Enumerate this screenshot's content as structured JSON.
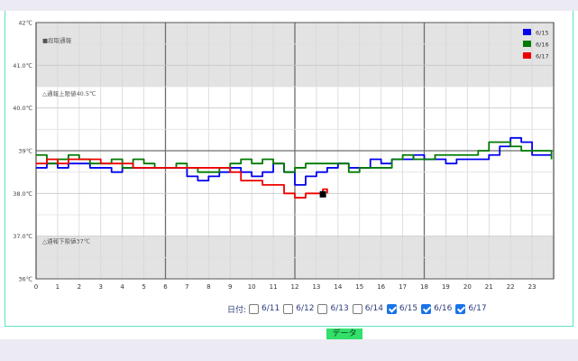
{
  "chart_data": {
    "type": "line",
    "x_range": [
      0,
      24
    ],
    "y_range": [
      36,
      42
    ],
    "x_ticks": [
      "0",
      "1",
      "2",
      "3",
      "4",
      "5",
      "6",
      "7",
      "8",
      "9",
      "10",
      "11",
      "12",
      "13",
      "14",
      "15",
      "16",
      "17",
      "18",
      "19",
      "20",
      "21",
      "22",
      "23"
    ],
    "y_ticks": [
      {
        "v": 36,
        "label": "36℃"
      },
      {
        "v": 37,
        "label": "37.0℃"
      },
      {
        "v": 38,
        "label": "38.0℃"
      },
      {
        "v": 39,
        "label": "39℃"
      },
      {
        "v": 40,
        "label": "40.0℃"
      },
      {
        "v": 41,
        "label": "41.0℃"
      },
      {
        "v": 42,
        "label": "42℃"
      }
    ],
    "bands": [
      {
        "from": 40.5,
        "to": 42,
        "label": "■段取通報",
        "label_y": 41.6,
        "color": "#e3e3e3"
      },
      {
        "from": 40.5,
        "to": 40.5,
        "label": "△通報上限値40.5℃",
        "label_y": 40.35,
        "color": ""
      },
      {
        "from": 36,
        "to": 37,
        "label": "△通報下限値37℃",
        "label_y": 36.9,
        "color": "#e3e3e3"
      }
    ],
    "series": [
      {
        "name": "6/15",
        "color": "#0000ee",
        "points": [
          [
            0,
            38.6
          ],
          [
            0.5,
            38.7
          ],
          [
            1,
            38.6
          ],
          [
            1.5,
            38.7
          ],
          [
            2,
            38.7
          ],
          [
            2.5,
            38.6
          ],
          [
            3,
            38.6
          ],
          [
            3.5,
            38.5
          ],
          [
            4,
            38.6
          ],
          [
            4.5,
            38.6
          ],
          [
            5,
            38.6
          ],
          [
            5.5,
            38.6
          ],
          [
            6,
            38.6
          ],
          [
            6.5,
            38.6
          ],
          [
            7,
            38.4
          ],
          [
            7.5,
            38.3
          ],
          [
            8,
            38.4
          ],
          [
            8.5,
            38.5
          ],
          [
            9,
            38.6
          ],
          [
            9.5,
            38.5
          ],
          [
            10,
            38.4
          ],
          [
            10.5,
            38.5
          ],
          [
            11,
            38.7
          ],
          [
            11.5,
            38.5
          ],
          [
            12,
            38.2
          ],
          [
            12.5,
            38.4
          ],
          [
            13,
            38.5
          ],
          [
            13.5,
            38.6
          ],
          [
            14,
            38.7
          ],
          [
            14.5,
            38.6
          ],
          [
            15,
            38.6
          ],
          [
            15.5,
            38.8
          ],
          [
            16,
            38.7
          ],
          [
            16.5,
            38.8
          ],
          [
            17,
            38.8
          ],
          [
            17.5,
            38.9
          ],
          [
            18,
            38.8
          ],
          [
            18.5,
            38.8
          ],
          [
            19,
            38.7
          ],
          [
            19.5,
            38.8
          ],
          [
            20,
            38.8
          ],
          [
            20.5,
            38.8
          ],
          [
            21,
            38.9
          ],
          [
            21.5,
            39.1
          ],
          [
            22,
            39.3
          ],
          [
            22.5,
            39.2
          ],
          [
            23,
            38.9
          ],
          [
            23.5,
            38.9
          ],
          [
            23.9,
            38.9
          ]
        ]
      },
      {
        "name": "6/16",
        "color": "#007a00",
        "points": [
          [
            0,
            38.9
          ],
          [
            0.5,
            38.7
          ],
          [
            1,
            38.8
          ],
          [
            1.5,
            38.9
          ],
          [
            2,
            38.8
          ],
          [
            2.5,
            38.7
          ],
          [
            3,
            38.7
          ],
          [
            3.5,
            38.8
          ],
          [
            4,
            38.6
          ],
          [
            4.5,
            38.8
          ],
          [
            5,
            38.7
          ],
          [
            5.5,
            38.6
          ],
          [
            6,
            38.6
          ],
          [
            6.5,
            38.7
          ],
          [
            7,
            38.6
          ],
          [
            7.5,
            38.5
          ],
          [
            8,
            38.5
          ],
          [
            8.5,
            38.6
          ],
          [
            9,
            38.7
          ],
          [
            9.5,
            38.8
          ],
          [
            10,
            38.7
          ],
          [
            10.5,
            38.8
          ],
          [
            11,
            38.7
          ],
          [
            11.5,
            38.5
          ],
          [
            12,
            38.6
          ],
          [
            12.5,
            38.7
          ],
          [
            13,
            38.7
          ],
          [
            13.5,
            38.7
          ],
          [
            14,
            38.7
          ],
          [
            14.5,
            38.5
          ],
          [
            15,
            38.6
          ],
          [
            15.5,
            38.6
          ],
          [
            16,
            38.6
          ],
          [
            16.5,
            38.8
          ],
          [
            17,
            38.9
          ],
          [
            17.5,
            38.8
          ],
          [
            18,
            38.8
          ],
          [
            18.5,
            38.9
          ],
          [
            19,
            38.9
          ],
          [
            19.5,
            38.9
          ],
          [
            20,
            38.9
          ],
          [
            20.5,
            39.0
          ],
          [
            21,
            39.2
          ],
          [
            21.5,
            39.2
          ],
          [
            22,
            39.1
          ],
          [
            22.5,
            39.0
          ],
          [
            23,
            39.0
          ],
          [
            23.5,
            39.0
          ],
          [
            23.9,
            38.8
          ]
        ]
      },
      {
        "name": "6/17",
        "color": "#ee0000",
        "points": [
          [
            0,
            38.7
          ],
          [
            0.5,
            38.8
          ],
          [
            1,
            38.7
          ],
          [
            1.5,
            38.8
          ],
          [
            2,
            38.8
          ],
          [
            2.5,
            38.8
          ],
          [
            3,
            38.7
          ],
          [
            3.5,
            38.7
          ],
          [
            4,
            38.7
          ],
          [
            4.5,
            38.6
          ],
          [
            5,
            38.6
          ],
          [
            5.5,
            38.6
          ],
          [
            6,
            38.6
          ],
          [
            6.5,
            38.6
          ],
          [
            7,
            38.6
          ],
          [
            7.5,
            38.6
          ],
          [
            8,
            38.6
          ],
          [
            8.5,
            38.6
          ],
          [
            9,
            38.5
          ],
          [
            9.5,
            38.3
          ],
          [
            10,
            38.3
          ],
          [
            10.5,
            38.2
          ],
          [
            11,
            38.2
          ],
          [
            11.5,
            38.0
          ],
          [
            12,
            37.9
          ],
          [
            12.5,
            38.0
          ],
          [
            13,
            38.0
          ],
          [
            13.3,
            38.1
          ],
          [
            13.5,
            38.0
          ]
        ]
      }
    ],
    "end_marker": [
      13.3,
      37.98
    ]
  },
  "legend": [
    "6/15",
    "6/16",
    "6/17"
  ],
  "date_filter": {
    "label": "日付:",
    "options": [
      {
        "label": "6/11",
        "checked": false
      },
      {
        "label": "6/12",
        "checked": false
      },
      {
        "label": "6/13",
        "checked": false
      },
      {
        "label": "6/14",
        "checked": false
      },
      {
        "label": "6/15",
        "checked": true
      },
      {
        "label": "6/16",
        "checked": true
      },
      {
        "label": "6/17",
        "checked": true
      }
    ]
  },
  "data_button_label": "データ"
}
